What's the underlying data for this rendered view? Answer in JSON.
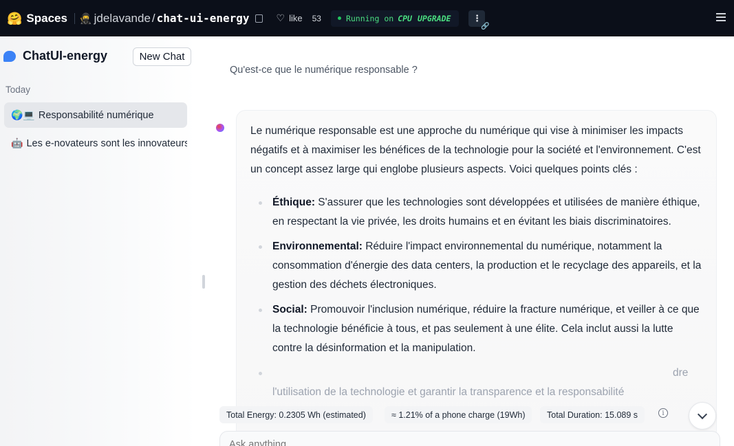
{
  "topbar": {
    "spaces_label": "Spaces",
    "owner_icon": "🥷",
    "owner": "jdelavande",
    "slash": "/",
    "repo": "chat-ui-energy",
    "like_label": "like",
    "like_count": "53",
    "status_label": "Running on",
    "hardware": "CPU",
    "upgrade_label": "UPGRADE",
    "kebab": "⋮"
  },
  "sidebar": {
    "brand": "ChatUI-energy",
    "new_chat_label": "New Chat",
    "section_label": "Today",
    "conversations": [
      {
        "emoji": "🌍💻",
        "title": "Responsabilité numérique"
      },
      {
        "emoji": "🤖",
        "title": "Les e-novateurs sont les innovateurs"
      }
    ]
  },
  "chat": {
    "question": "Qu'est-ce que le numérique responsable ?",
    "intro": "Le numérique responsable est une approche du numérique qui vise à minimiser les impacts négatifs et à maximiser les bénéfices de la technologie pour la société et l'environnement. C'est un concept assez large qui englobe plusieurs aspects. Voici quelques points clés :",
    "points": [
      {
        "term": "Éthique:",
        "text": " S'assurer que les technologies sont développées et utilisées de manière éthique, en respectant la vie privée, les droits humains et en évitant les biais discriminatoires."
      },
      {
        "term": "Environnemental:",
        "text": " Réduire l'impact environnemental du numérique, notamment la consommation d'énergie des data centers, la production et le recyclage des appareils, et la gestion des déchets électroniques."
      },
      {
        "term": "Social:",
        "text": " Promouvoir l'inclusion numérique, réduire la fracture numérique, et veiller à ce que la technologie bénéficie à tous, et pas seulement à une élite. Cela inclut aussi la lutte contre la désinformation et la manipulation."
      }
    ],
    "partial_line_end": "dre",
    "partial_line": "l'utilisation de la technologie et garantir la transparence et la responsabilité"
  },
  "energy": {
    "total_energy": "Total Energy: 0.2305 Wh (estimated)",
    "phone_charge": "≈ 1.21% of a phone charge (19Wh)",
    "total_duration": "Total Duration: 15.089 s",
    "info": "i"
  },
  "input": {
    "placeholder": "Ask anything"
  }
}
